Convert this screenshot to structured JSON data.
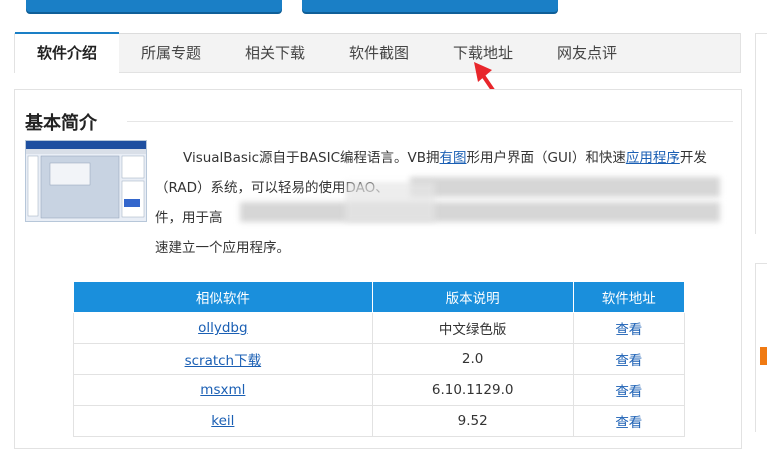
{
  "tabs": [
    {
      "label": "软件介绍",
      "active": true
    },
    {
      "label": "所属专题",
      "active": false
    },
    {
      "label": "相关下载",
      "active": false
    },
    {
      "label": "软件截图",
      "active": false
    },
    {
      "label": "下载地址",
      "active": false
    },
    {
      "label": "网友点评",
      "active": false
    }
  ],
  "section": {
    "title": "基本简介"
  },
  "description": {
    "p1_a": "VisualBasic源自于BASIC编程语言。VB拥",
    "p1_link1": "有图",
    "p1_b": "形用户界面（GUI）和快速",
    "p1_link2": "应用程序",
    "p1_c": "开发",
    "line2": "（RAD）系统，可以轻易的使用DAO、",
    "line3": "件，用于高",
    "line4": "速建立一个应用程序。"
  },
  "table": {
    "headers": [
      "相似软件",
      "版本说明",
      "软件地址"
    ],
    "rows": [
      {
        "name": "ollydbg",
        "version": "中文绿色版",
        "link": "查看"
      },
      {
        "name": "scratch下载",
        "version": "2.0",
        "link": "查看"
      },
      {
        "name": "msxml",
        "version": "6.10.1129.0",
        "link": "查看"
      },
      {
        "name": "keil",
        "version": "9.52",
        "link": "查看"
      }
    ]
  },
  "colors": {
    "accent": "#1a7fc6",
    "table_header": "#1a8fdc",
    "link": "#1a5fb4",
    "arrow": "#e8262b"
  }
}
